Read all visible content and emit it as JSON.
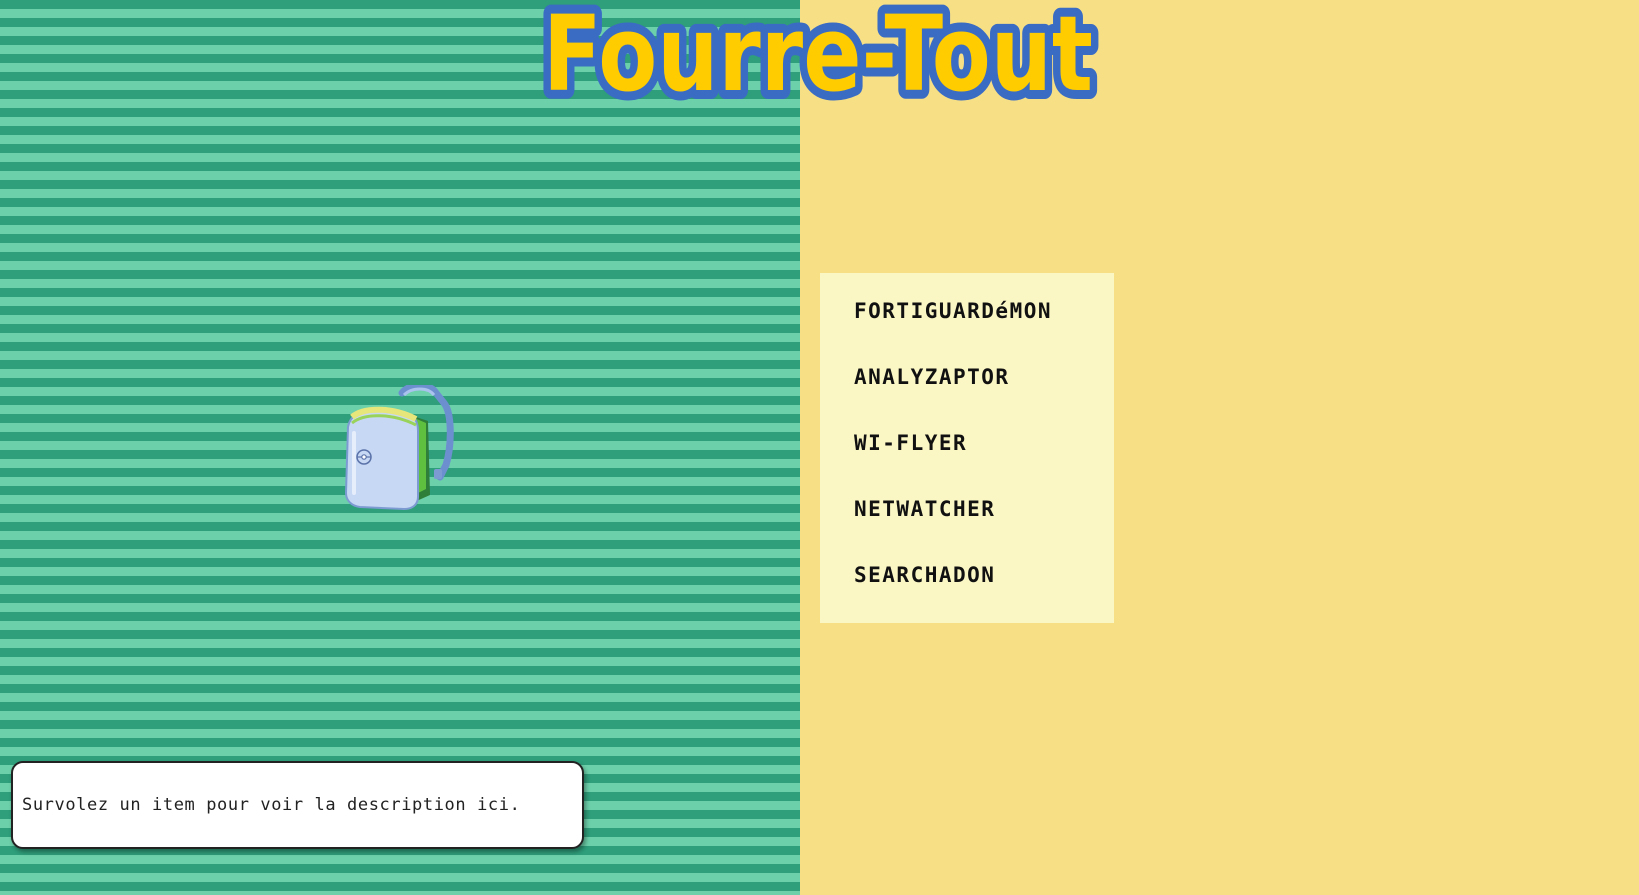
{
  "logo": {
    "text": "Fourre-Tout",
    "fill_color": "#ffcc00",
    "outline_color": "#3a6cc4"
  },
  "bag": {
    "icon": "backpack-icon"
  },
  "menu": {
    "items": [
      {
        "label": "FORTIGUARDéMON"
      },
      {
        "label": "ANALYZAPTOR"
      },
      {
        "label": "WI-FLYER"
      },
      {
        "label": "NETWATCHER"
      },
      {
        "label": "SEARCHADON"
      }
    ]
  },
  "description": {
    "text": "Survolez un item pour voir la description ici."
  },
  "colors": {
    "stripe_dark": "#2f9e7a",
    "stripe_light": "#6cd0aa",
    "right_background": "#f7df86",
    "menu_background": "#fbf7c5"
  }
}
